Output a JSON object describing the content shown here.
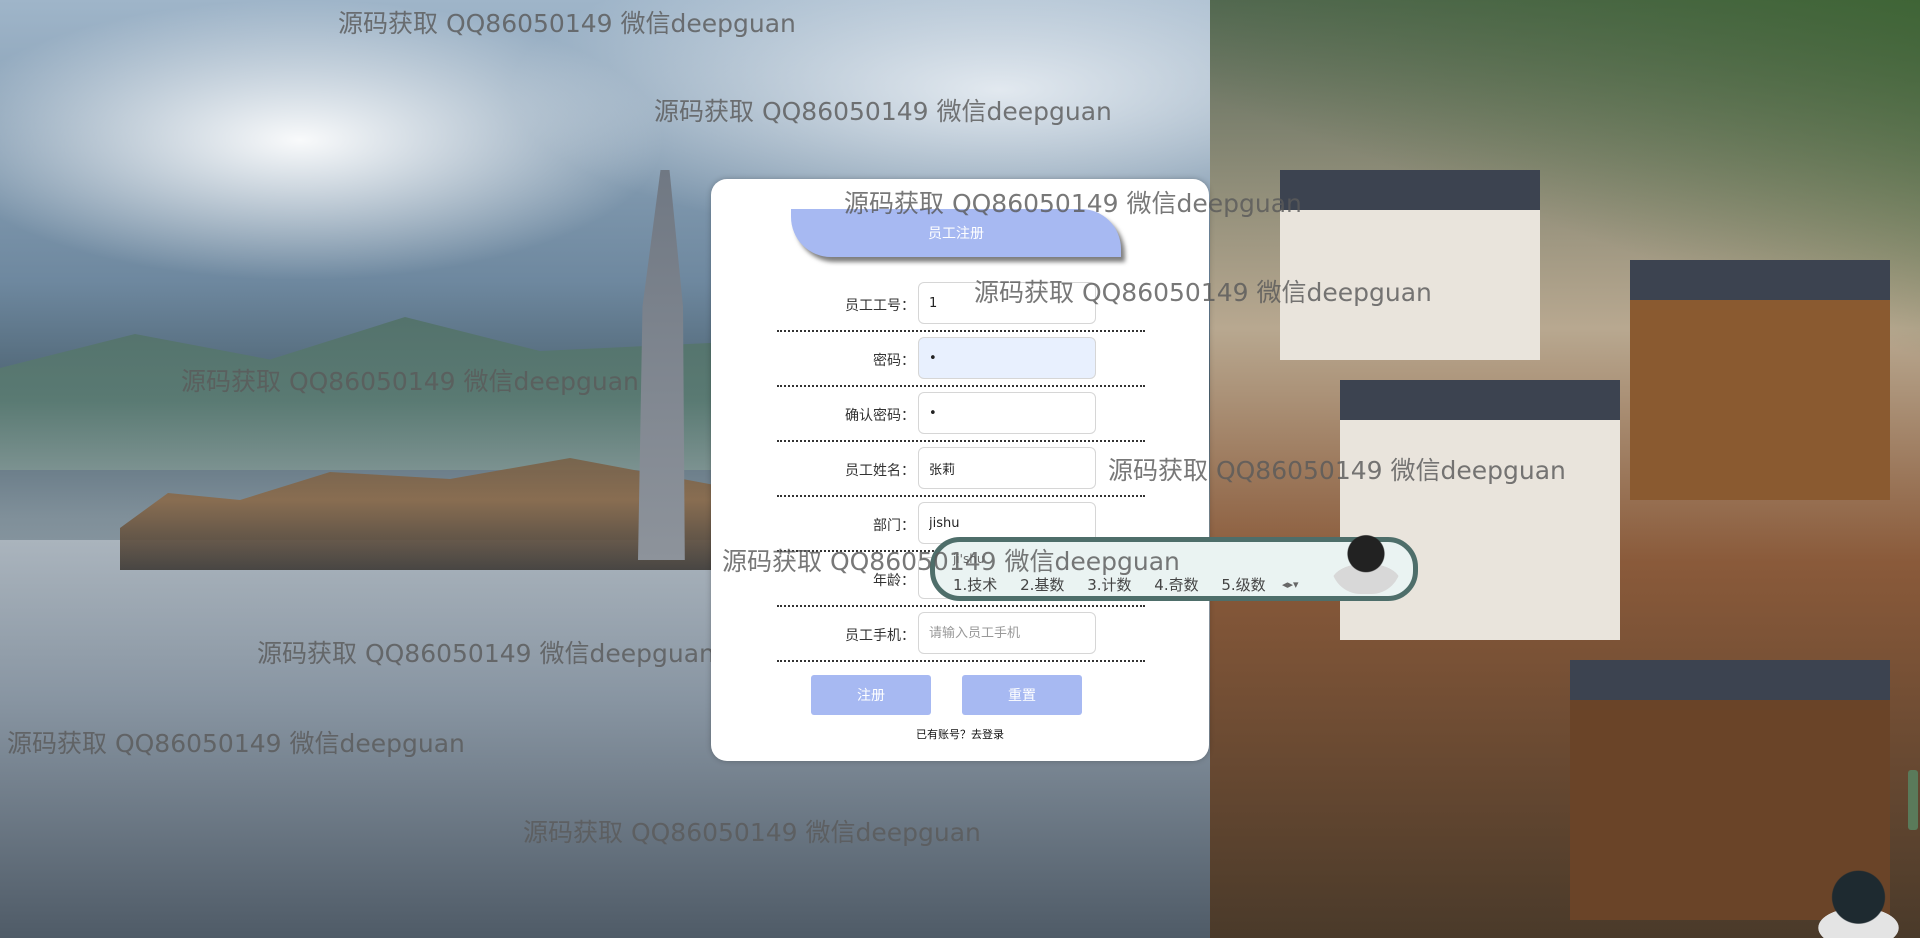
{
  "watermark": "源码获取 QQ86050149 微信deepguan",
  "form": {
    "title": "员工注册",
    "fields": [
      {
        "label": "员工工号：",
        "value": "1",
        "placeholder": "",
        "type": "text"
      },
      {
        "label": "密码：",
        "value": "•",
        "placeholder": "",
        "type": "text"
      },
      {
        "label": "确认密码：",
        "value": "•",
        "placeholder": "",
        "type": "text"
      },
      {
        "label": "员工姓名：",
        "value": "张莉",
        "placeholder": "",
        "type": "text"
      },
      {
        "label": "部门：",
        "value": "jishu",
        "placeholder": "",
        "type": "text"
      },
      {
        "label": "年龄：",
        "value": "",
        "placeholder": "",
        "type": "text"
      },
      {
        "label": "员工手机：",
        "value": "",
        "placeholder": "请输入员工手机",
        "type": "text"
      }
    ],
    "register_label": "注册",
    "reset_label": "重置",
    "login_link": "已有账号？去登录"
  },
  "ime": {
    "composition": "ji'shu",
    "candidates": [
      "1.技术",
      "2.基数",
      "3.计数",
      "4.奇数",
      "5.级数"
    ],
    "page_arrows": "◂▸▾"
  },
  "colors": {
    "accent": "#a7b9f2",
    "card_bg": "#ffffff",
    "ime_border": "#4e6e6a"
  }
}
